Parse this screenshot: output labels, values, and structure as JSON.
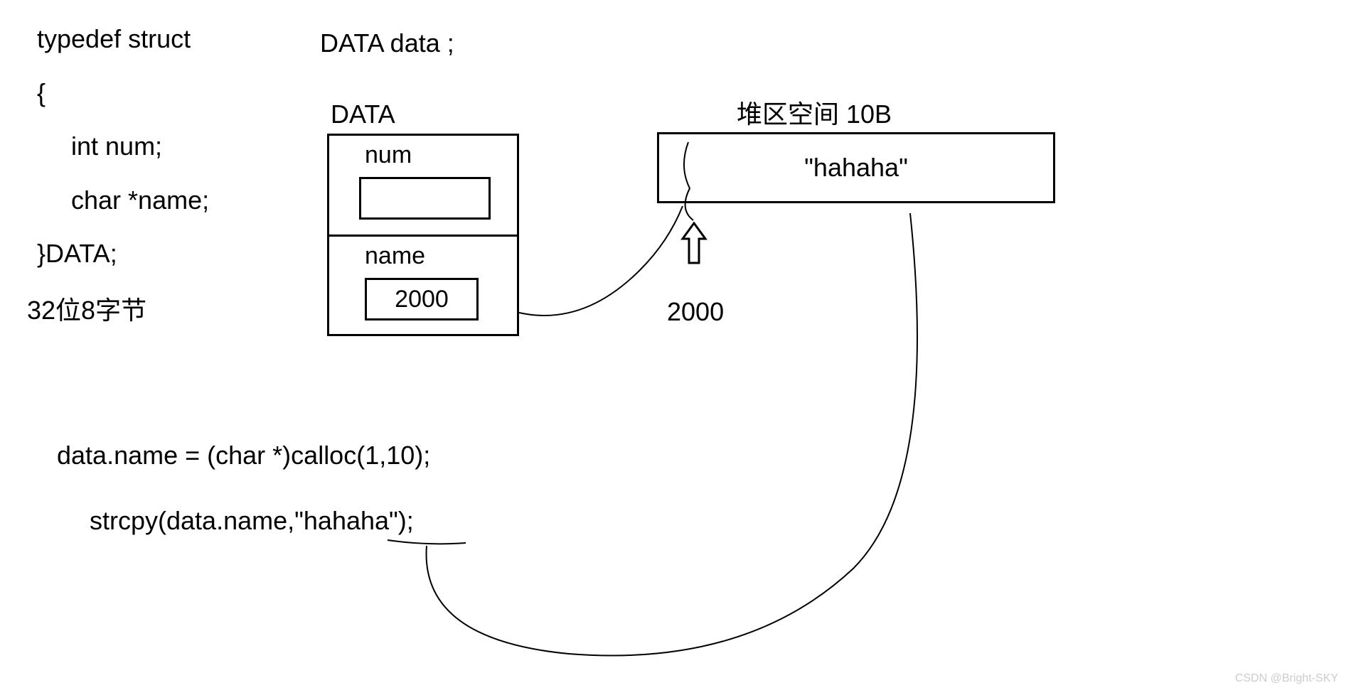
{
  "code": {
    "line1": "typedef struct",
    "line2": "{",
    "line3": "int num;",
    "line4": "char *name;",
    "line5": "}DATA;"
  },
  "size_note": "32位8字节",
  "declaration": "DATA data  ;",
  "struct_diagram": {
    "label": "DATA",
    "field_num": "num",
    "field_name": "name",
    "name_value": "2000"
  },
  "heap": {
    "label": "堆区空间  10B",
    "content": "\"hahaha\"",
    "address": "2000"
  },
  "operations": {
    "calloc": "data.name = (char *)calloc(1,10);",
    "strcpy": "strcpy(data.name,\"hahaha\");"
  },
  "watermark": "CSDN @Bright-SKY"
}
